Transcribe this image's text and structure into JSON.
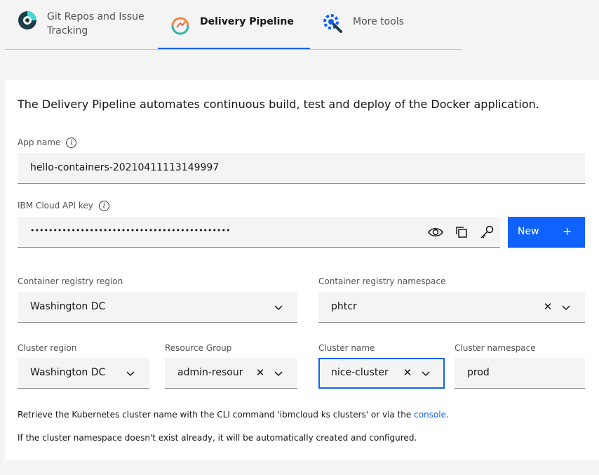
{
  "tabs": [
    {
      "label_line1": "Git Repos and Issue",
      "label_line2": "Tracking",
      "icon": "git-repos-icon"
    },
    {
      "label": "Delivery Pipeline",
      "icon": "delivery-pipeline-icon",
      "active": true
    },
    {
      "label": "More tools",
      "icon": "more-tools-icon"
    }
  ],
  "intro": "The Delivery Pipeline automates continuous build, test and deploy of the Docker application.",
  "app_name": {
    "label": "App name",
    "value": "hello-containers-20210411113149997"
  },
  "api_key": {
    "label": "IBM Cloud API key",
    "value": "••••••••••••••••••••••••••••••••••••••••••••",
    "new_label": "New",
    "new_icon": "+"
  },
  "registry_region": {
    "label": "Container registry region",
    "value": "Washington DC"
  },
  "registry_namespace": {
    "label": "Container registry namespace",
    "value": "phtcr"
  },
  "cluster_region": {
    "label": "Cluster region",
    "value": "Washington DC"
  },
  "resource_group": {
    "label": "Resource Group",
    "value": "admin-resour"
  },
  "cluster_name": {
    "label": "Cluster name",
    "value": "nice-cluster"
  },
  "cluster_namespace": {
    "label": "Cluster namespace",
    "value": "prod"
  },
  "notes": {
    "retrieve_prefix": "Retrieve the Kubernetes cluster name with the CLI command 'ibmcloud ks clusters' or via the ",
    "console_link": "console",
    "retrieve_suffix": ".",
    "namespace_note": "If the cluster namespace doesn't exist already, it will be automatically created and configured."
  },
  "colors": {
    "accent": "#0f62fe",
    "field_bg": "#f4f4f4",
    "panel_bg": "#ffffff"
  }
}
